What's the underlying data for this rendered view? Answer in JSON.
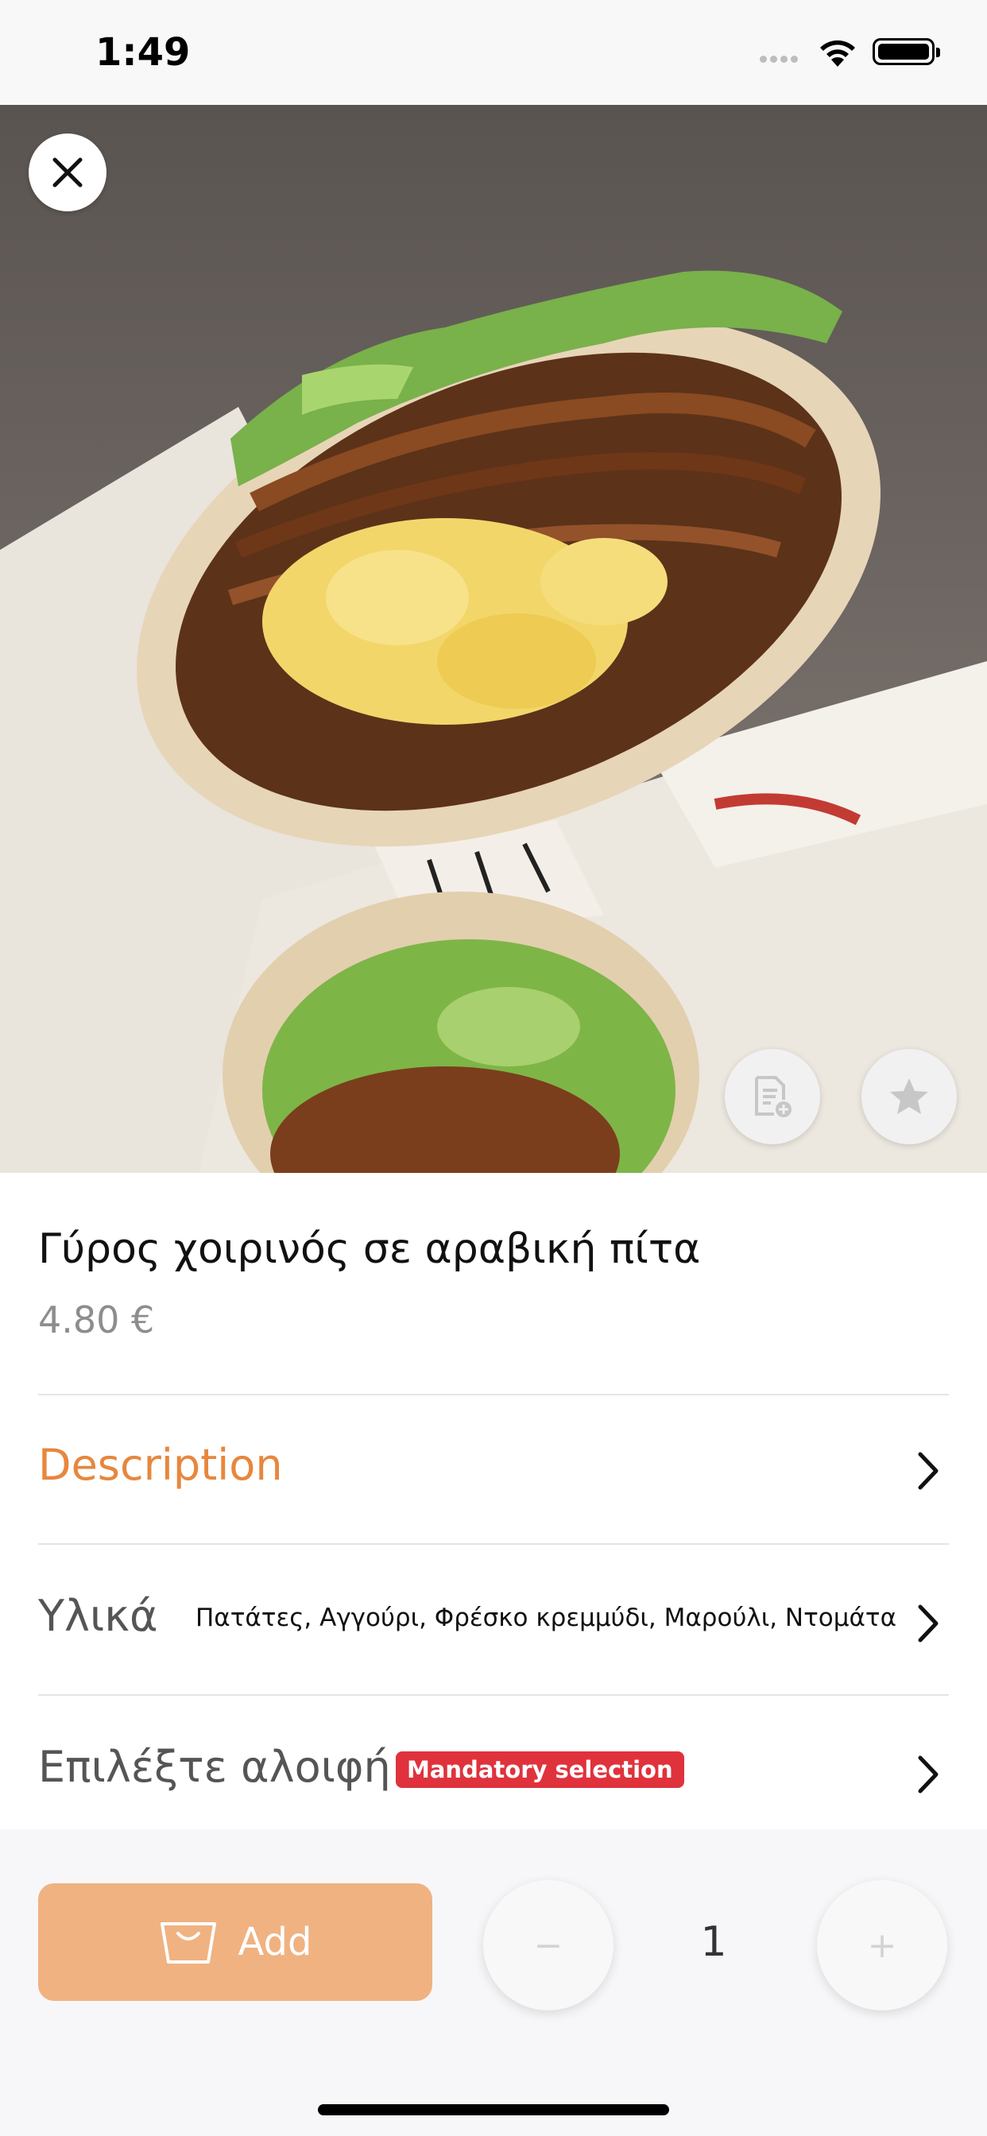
{
  "status_bar": {
    "time": "1:49"
  },
  "product": {
    "image_subject": "gyro wrap",
    "title": "Γύρος χοιρινός σε αραβική πίτα",
    "price": "4.80 €"
  },
  "rows": {
    "description_label": "Description",
    "ingredients_label": "Υλικά",
    "ingredients_value": "Πατάτες, Αγγούρι, Φρέσκο κρεμμύδι, Μαρούλι, Ντομάτα",
    "sauce_label": "Επιλέξτε αλοιφή",
    "mandatory_badge": "Mandatory selection"
  },
  "actions": {
    "add_label": "Add",
    "quantity": "1",
    "minus": "−",
    "plus": "+"
  },
  "colors": {
    "accent": "#e7873e",
    "add_button": "#f0b281",
    "mandatory": "#e0323c"
  }
}
